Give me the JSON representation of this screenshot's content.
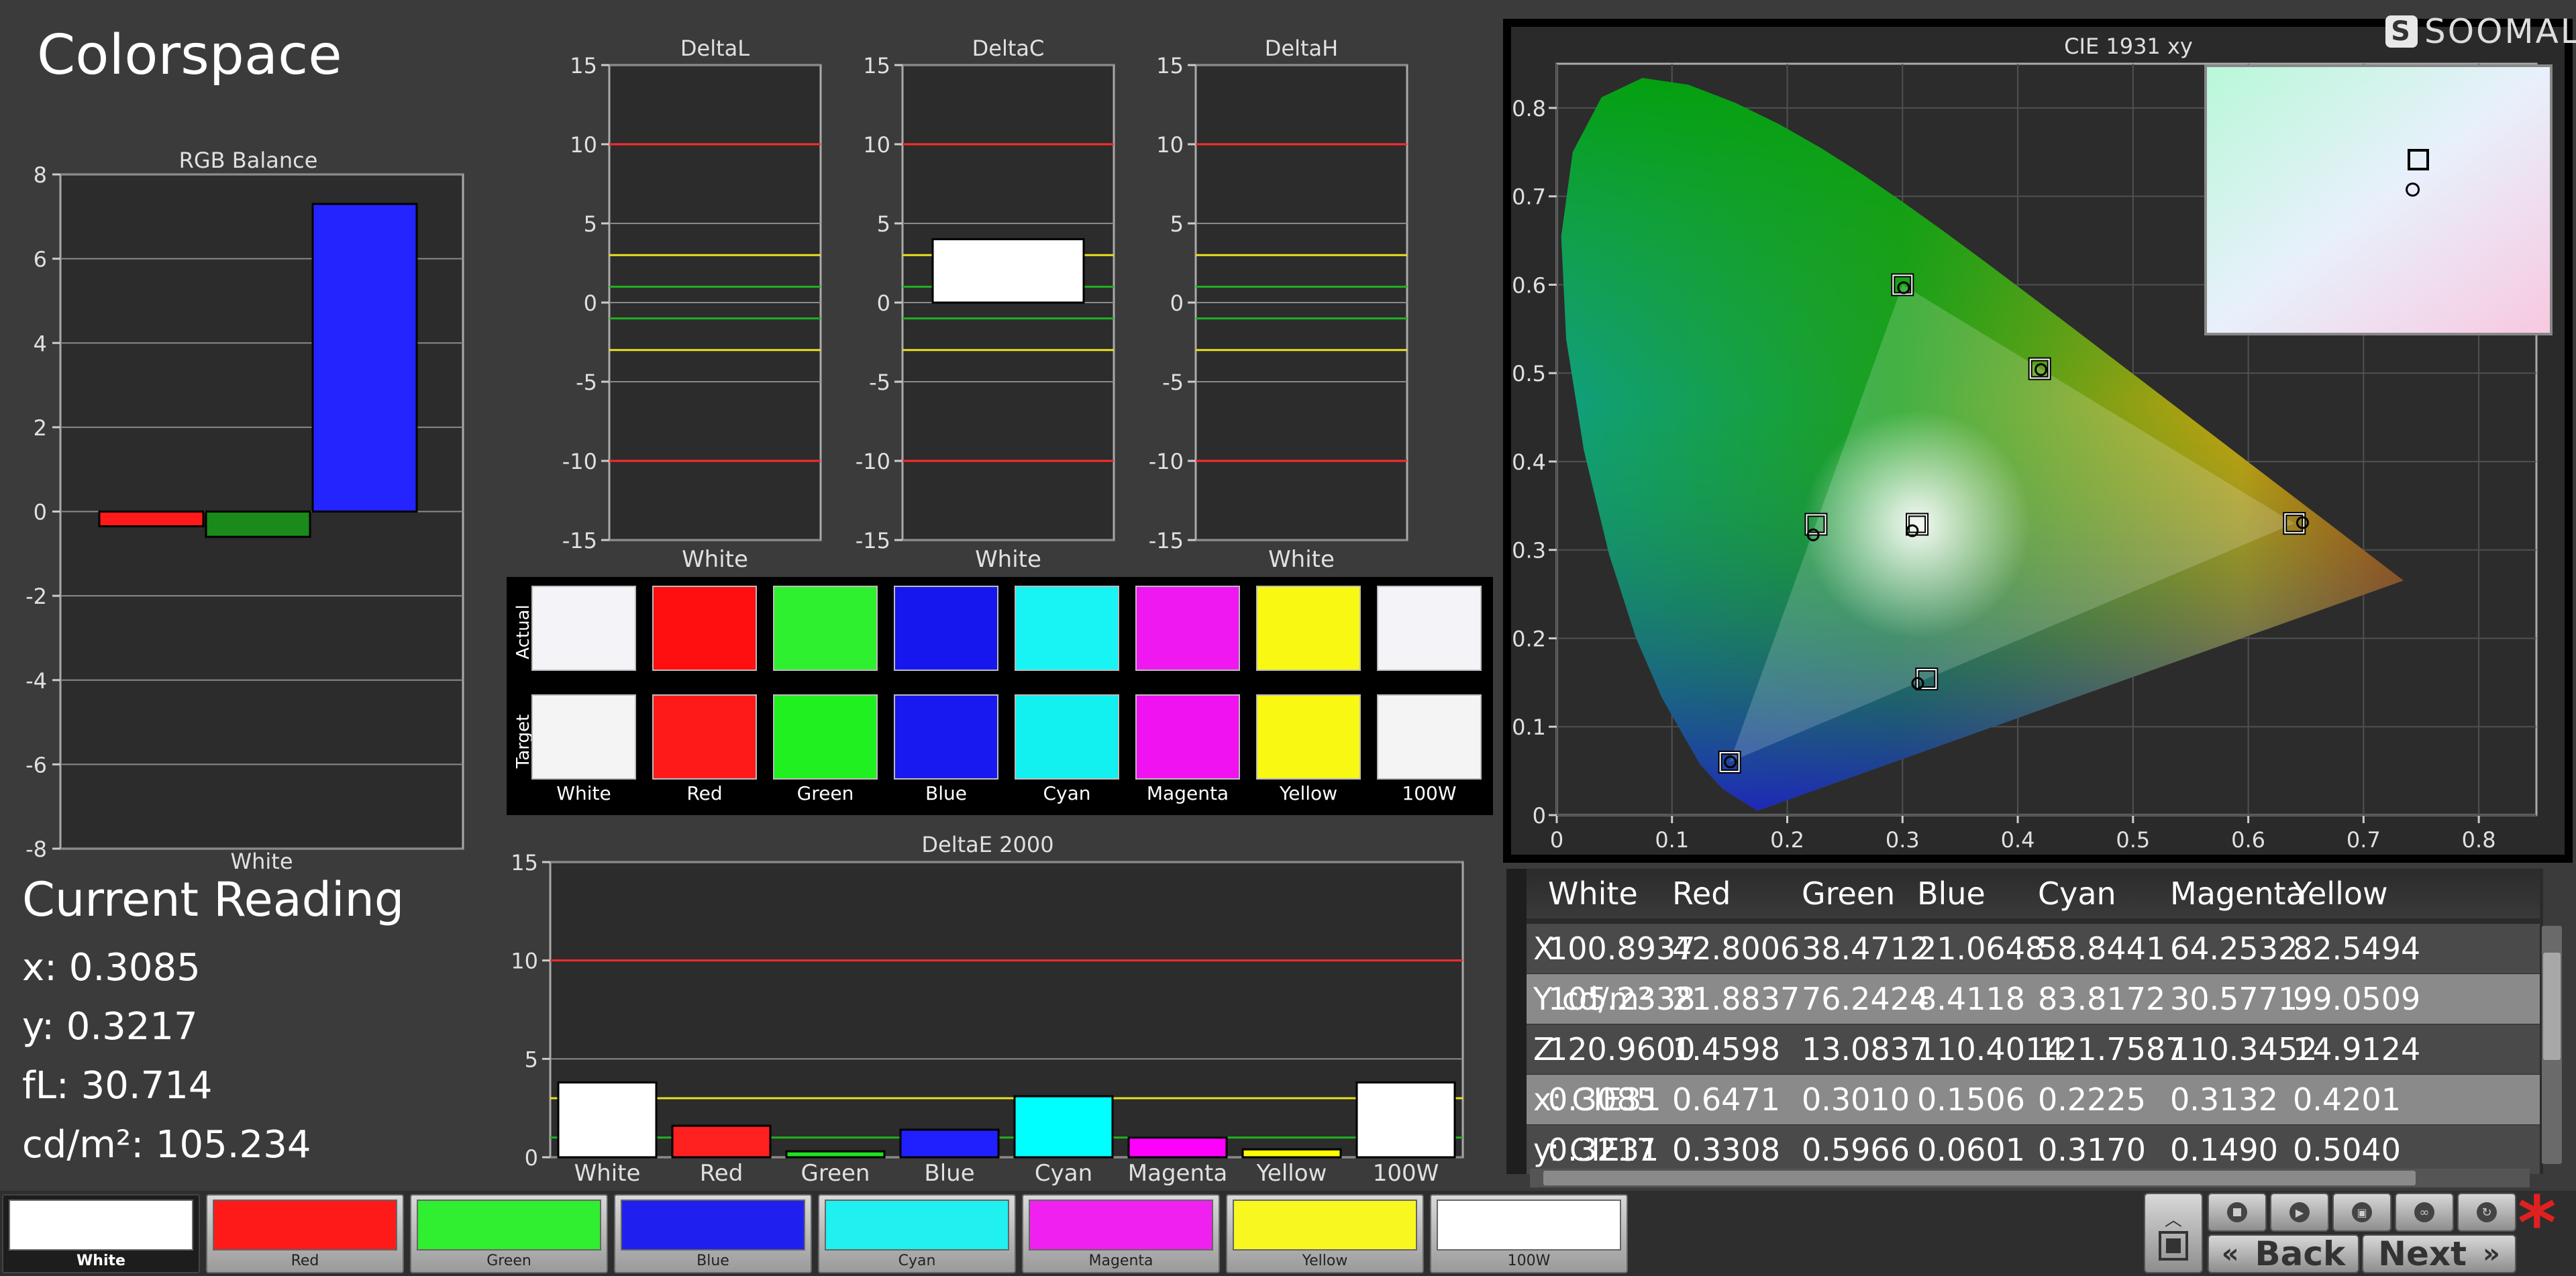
{
  "title": "Colorspace",
  "brand": {
    "logo_letter": "S",
    "name": "SOOMAL"
  },
  "current_reading": {
    "title": "Current Reading",
    "x": "x: 0.3085",
    "y": "y: 0.3217",
    "fl": "fL: 30.714",
    "cdm": "cd/m²: 105.234"
  },
  "chart_data": [
    {
      "type": "bar",
      "title": "RGB Balance",
      "categories": [
        "White"
      ],
      "series": [
        {
          "name": "Red",
          "values": [
            -0.35
          ],
          "color": "#ff1a1a"
        },
        {
          "name": "Green",
          "values": [
            -0.6
          ],
          "color": "#1a8a1a"
        },
        {
          "name": "Blue",
          "values": [
            7.3
          ],
          "color": "#2424ff"
        }
      ],
      "ylim": [
        -8,
        8
      ],
      "yticks": [
        8,
        6,
        4,
        2,
        0,
        -2,
        -4,
        -6,
        -8
      ],
      "grid": true
    },
    {
      "type": "bar",
      "title": "DeltaL",
      "categories": [
        "White"
      ],
      "values": [
        0
      ],
      "ylim": [
        -15,
        15
      ],
      "yticks": [
        15,
        10,
        5,
        0,
        -5,
        -10,
        -15
      ],
      "reference_lines": [
        {
          "y": 10,
          "color": "#ff2a2a"
        },
        {
          "y": -10,
          "color": "#ff2a2a"
        },
        {
          "y": 3,
          "color": "#e8e020"
        },
        {
          "y": -3,
          "color": "#e8e020"
        },
        {
          "y": 1,
          "color": "#20b020"
        },
        {
          "y": -1,
          "color": "#20b020"
        }
      ]
    },
    {
      "type": "bar",
      "title": "DeltaC",
      "categories": [
        "White"
      ],
      "values": [
        4.0
      ],
      "ylim": [
        -15,
        15
      ],
      "yticks": [
        15,
        10,
        5,
        0,
        -5,
        -10,
        -15
      ],
      "reference_lines": [
        {
          "y": 10,
          "color": "#ff2a2a"
        },
        {
          "y": -10,
          "color": "#ff2a2a"
        },
        {
          "y": 3,
          "color": "#e8e020"
        },
        {
          "y": -3,
          "color": "#e8e020"
        },
        {
          "y": 1,
          "color": "#20b020"
        },
        {
          "y": -1,
          "color": "#20b020"
        }
      ]
    },
    {
      "type": "bar",
      "title": "DeltaH",
      "categories": [
        "White"
      ],
      "values": [
        0
      ],
      "ylim": [
        -15,
        15
      ],
      "yticks": [
        15,
        10,
        5,
        0,
        -5,
        -10,
        -15
      ],
      "reference_lines": [
        {
          "y": 10,
          "color": "#ff2a2a"
        },
        {
          "y": -10,
          "color": "#ff2a2a"
        },
        {
          "y": 3,
          "color": "#e8e020"
        },
        {
          "y": -3,
          "color": "#e8e020"
        },
        {
          "y": 1,
          "color": "#20b020"
        },
        {
          "y": -1,
          "color": "#20b020"
        }
      ]
    },
    {
      "type": "bar",
      "title": "DeltaE 2000",
      "categories": [
        "White",
        "Red",
        "Green",
        "Blue",
        "Cyan",
        "Magenta",
        "Yellow",
        "100W"
      ],
      "values": [
        3.8,
        1.6,
        0.3,
        1.4,
        3.1,
        1.0,
        0.4,
        3.8
      ],
      "colors": [
        "#ffffff",
        "#ff2020",
        "#20e020",
        "#2020ff",
        "#00ffff",
        "#ff00ff",
        "#ffff00",
        "#ffffff"
      ],
      "ylim": [
        0,
        15
      ],
      "yticks": [
        15,
        10,
        5,
        0
      ],
      "reference_lines": [
        {
          "y": 10,
          "color": "#ff2a2a"
        },
        {
          "y": 3,
          "color": "#e8e020"
        },
        {
          "y": 1,
          "color": "#20b020"
        }
      ]
    },
    {
      "type": "scatter",
      "title": "CIE 1931 xy",
      "xlim": [
        0,
        0.85
      ],
      "ylim": [
        0,
        0.85
      ],
      "xticks": [
        0,
        0.1,
        0.2,
        0.3,
        0.4,
        0.5,
        0.6,
        0.7,
        0.8
      ],
      "yticks": [
        0,
        0.1,
        0.2,
        0.3,
        0.4,
        0.5,
        0.6,
        0.7,
        0.8
      ],
      "targets": [
        {
          "name": "Red",
          "x": 0.64,
          "y": 0.33
        },
        {
          "name": "Green",
          "x": 0.3,
          "y": 0.6
        },
        {
          "name": "Blue",
          "x": 0.15,
          "y": 0.06
        },
        {
          "name": "Cyan",
          "x": 0.225,
          "y": 0.329
        },
        {
          "name": "Magenta",
          "x": 0.321,
          "y": 0.154
        },
        {
          "name": "Yellow",
          "x": 0.419,
          "y": 0.505
        },
        {
          "name": "White",
          "x": 0.3127,
          "y": 0.329
        }
      ],
      "measured": [
        {
          "name": "White",
          "x": 0.3085,
          "y": 0.3217
        },
        {
          "name": "Red",
          "x": 0.6471,
          "y": 0.3308
        },
        {
          "name": "Green",
          "x": 0.301,
          "y": 0.5966
        },
        {
          "name": "Blue",
          "x": 0.1506,
          "y": 0.0601
        },
        {
          "name": "Cyan",
          "x": 0.2225,
          "y": 0.317
        },
        {
          "name": "Magenta",
          "x": 0.3132,
          "y": 0.149
        },
        {
          "name": "Yellow",
          "x": 0.4201,
          "y": 0.504
        }
      ]
    }
  ],
  "patches": {
    "row_labels": [
      "Actual",
      "Target"
    ],
    "labels": [
      "White",
      "Red",
      "Green",
      "Blue",
      "Cyan",
      "Magenta",
      "Yellow",
      "100W"
    ],
    "actual_colors": [
      "#f4f4f8",
      "#ff0f0f",
      "#2ff02f",
      "#1616ee",
      "#18f4f4",
      "#f018f0",
      "#f8f812",
      "#f4f4f8"
    ],
    "target_colors": [
      "#f4f4f4",
      "#ff1a1a",
      "#20f020",
      "#1818f0",
      "#12f0f0",
      "#f012f0",
      "#f8f812",
      "#f4f4f4"
    ]
  },
  "table": {
    "headers": [
      "",
      "White",
      "Red",
      "Green",
      "Blue",
      "Cyan",
      "Magenta",
      "Yellow"
    ],
    "rows": [
      [
        "X",
        "100.8937",
        "42.8006",
        "38.4712",
        "21.0648",
        "58.8441",
        "64.2532",
        "82.5494"
      ],
      [
        "Y cd/m²",
        "105.2338",
        "21.8837",
        "76.2424",
        "8.4118",
        "83.8172",
        "30.5771",
        "99.0509"
      ],
      [
        "Z",
        "120.9600",
        "1.4598",
        "13.0837",
        "110.4014",
        "121.7587",
        "110.3452",
        "14.9124"
      ],
      [
        "x: CIE31",
        "0.3085",
        "0.6471",
        "0.3010",
        "0.1506",
        "0.2225",
        "0.3132",
        "0.4201"
      ],
      [
        "y: CIE31",
        "0.3217",
        "0.3308",
        "0.5966",
        "0.0601",
        "0.3170",
        "0.1490",
        "0.5040"
      ]
    ]
  },
  "bottom_swatches": [
    {
      "label": "White",
      "color": "#ffffff"
    },
    {
      "label": "Red",
      "color": "#ff1a1a"
    },
    {
      "label": "Green",
      "color": "#30ee30"
    },
    {
      "label": "Blue",
      "color": "#2020ee"
    },
    {
      "label": "Cyan",
      "color": "#20f0f0"
    },
    {
      "label": "Magenta",
      "color": "#f020f0"
    },
    {
      "label": "Yellow",
      "color": "#f8f820"
    },
    {
      "label": "100W",
      "color": "#ffffff"
    }
  ],
  "nav": {
    "back": "Back",
    "next": "Next",
    "asterisk": "*"
  }
}
